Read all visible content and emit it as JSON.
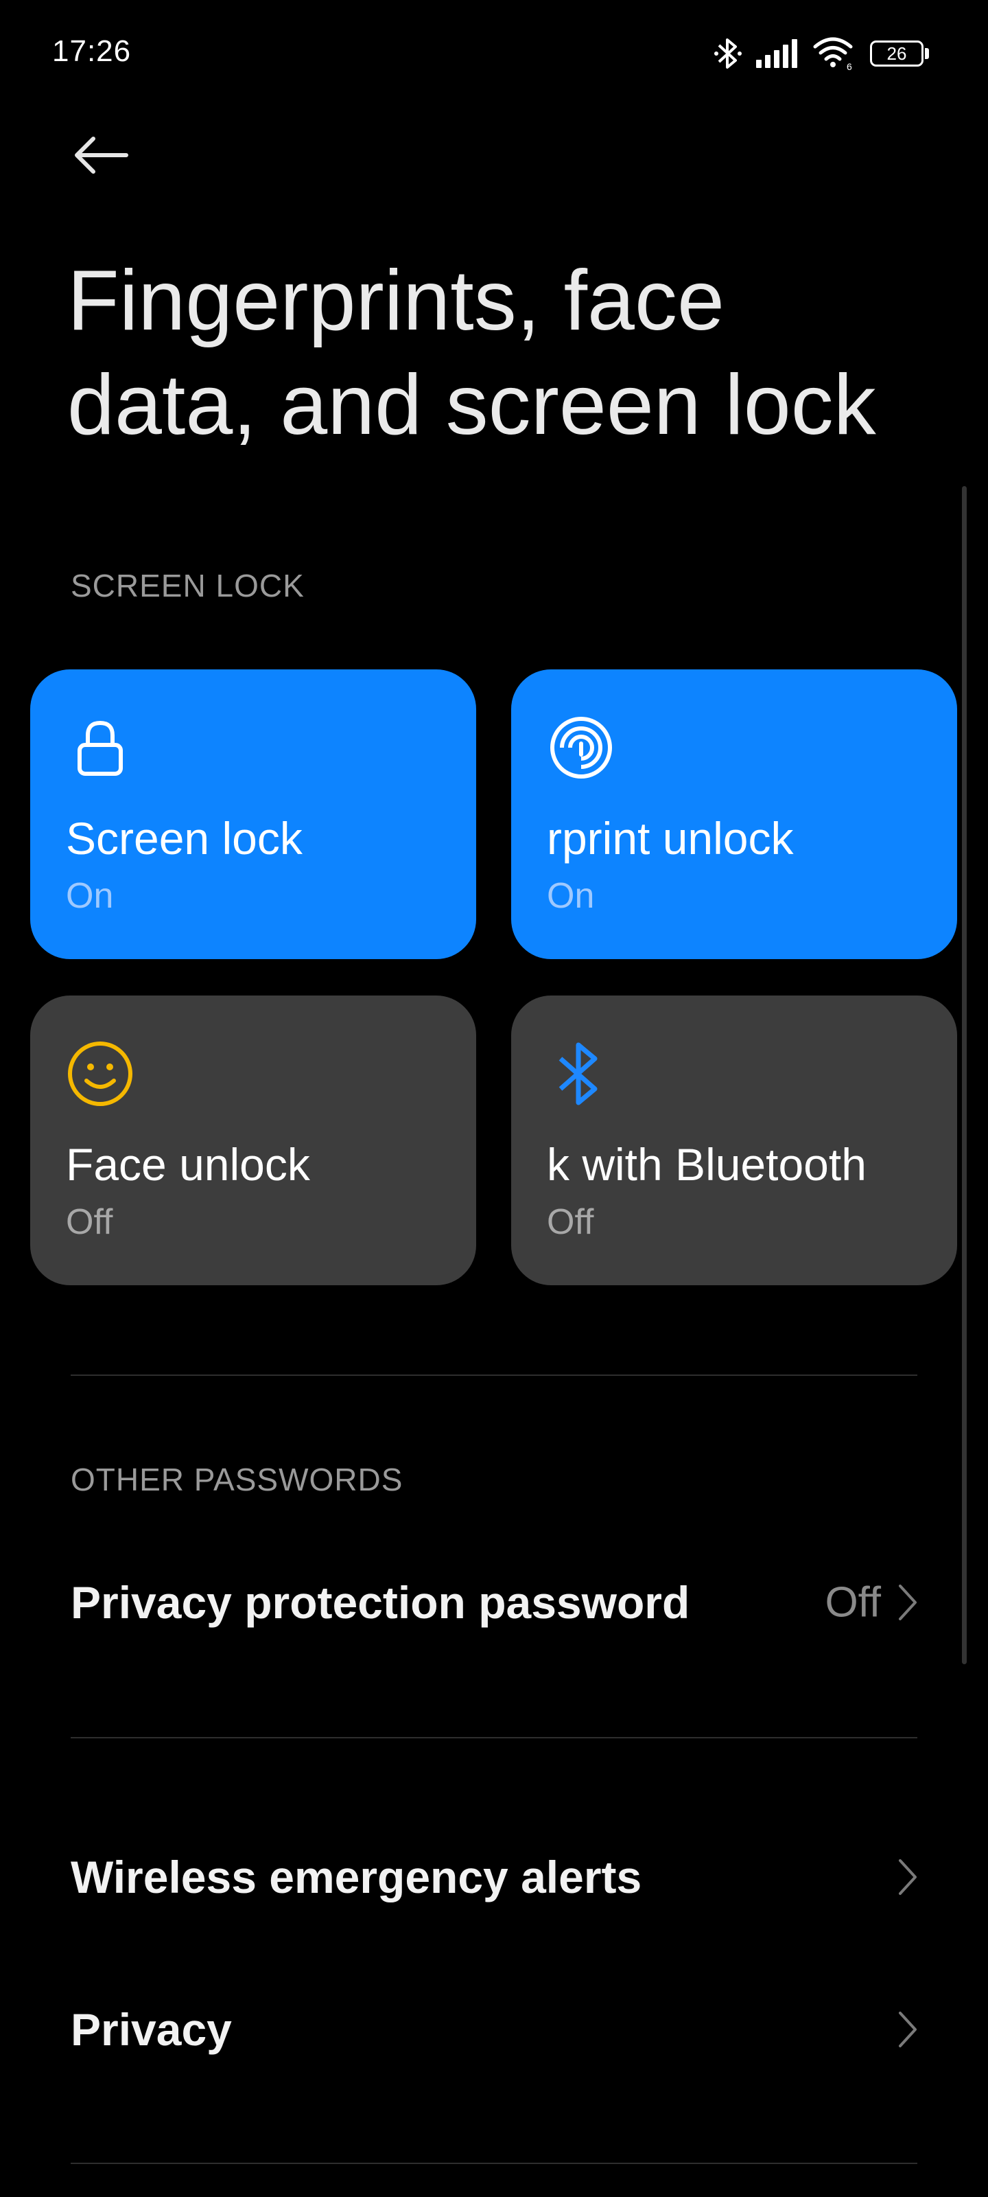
{
  "status_bar": {
    "time": "17:26",
    "battery_level": "26",
    "battery_fraction": 0.26,
    "icons": [
      "bluetooth-icon",
      "signal-icon",
      "wifi-icon",
      "battery-icon"
    ]
  },
  "header": {
    "back_icon": "arrow-left-icon",
    "title": "Fingerprints, face data, and screen lock"
  },
  "screen_lock_section": {
    "header": "SCREEN LOCK",
    "tiles": [
      {
        "icon": "lock-icon",
        "label": "Screen lock",
        "status": "On",
        "state": "on"
      },
      {
        "icon": "fingerprint-icon",
        "label": "rprint unlock",
        "status": "On",
        "state": "on"
      },
      {
        "icon": "smiley-icon",
        "label": "Face unlock",
        "status": "Off",
        "state": "off"
      },
      {
        "icon": "bluetooth-icon",
        "label": "k with Bluetooth",
        "status": "Off",
        "state": "off"
      }
    ]
  },
  "other_passwords_section": {
    "header": "OTHER PASSWORDS",
    "items": [
      {
        "label": "Privacy protection password",
        "value": "Off"
      }
    ]
  },
  "more_items": [
    {
      "label": "Wireless emergency alerts"
    },
    {
      "label": "Privacy"
    }
  ],
  "colors": {
    "background": "#000000",
    "tile_on": "#0d84ff",
    "tile_off": "#3d3d3d",
    "face_icon": "#f5b800",
    "bluetooth_icon": "#1e88ff"
  }
}
